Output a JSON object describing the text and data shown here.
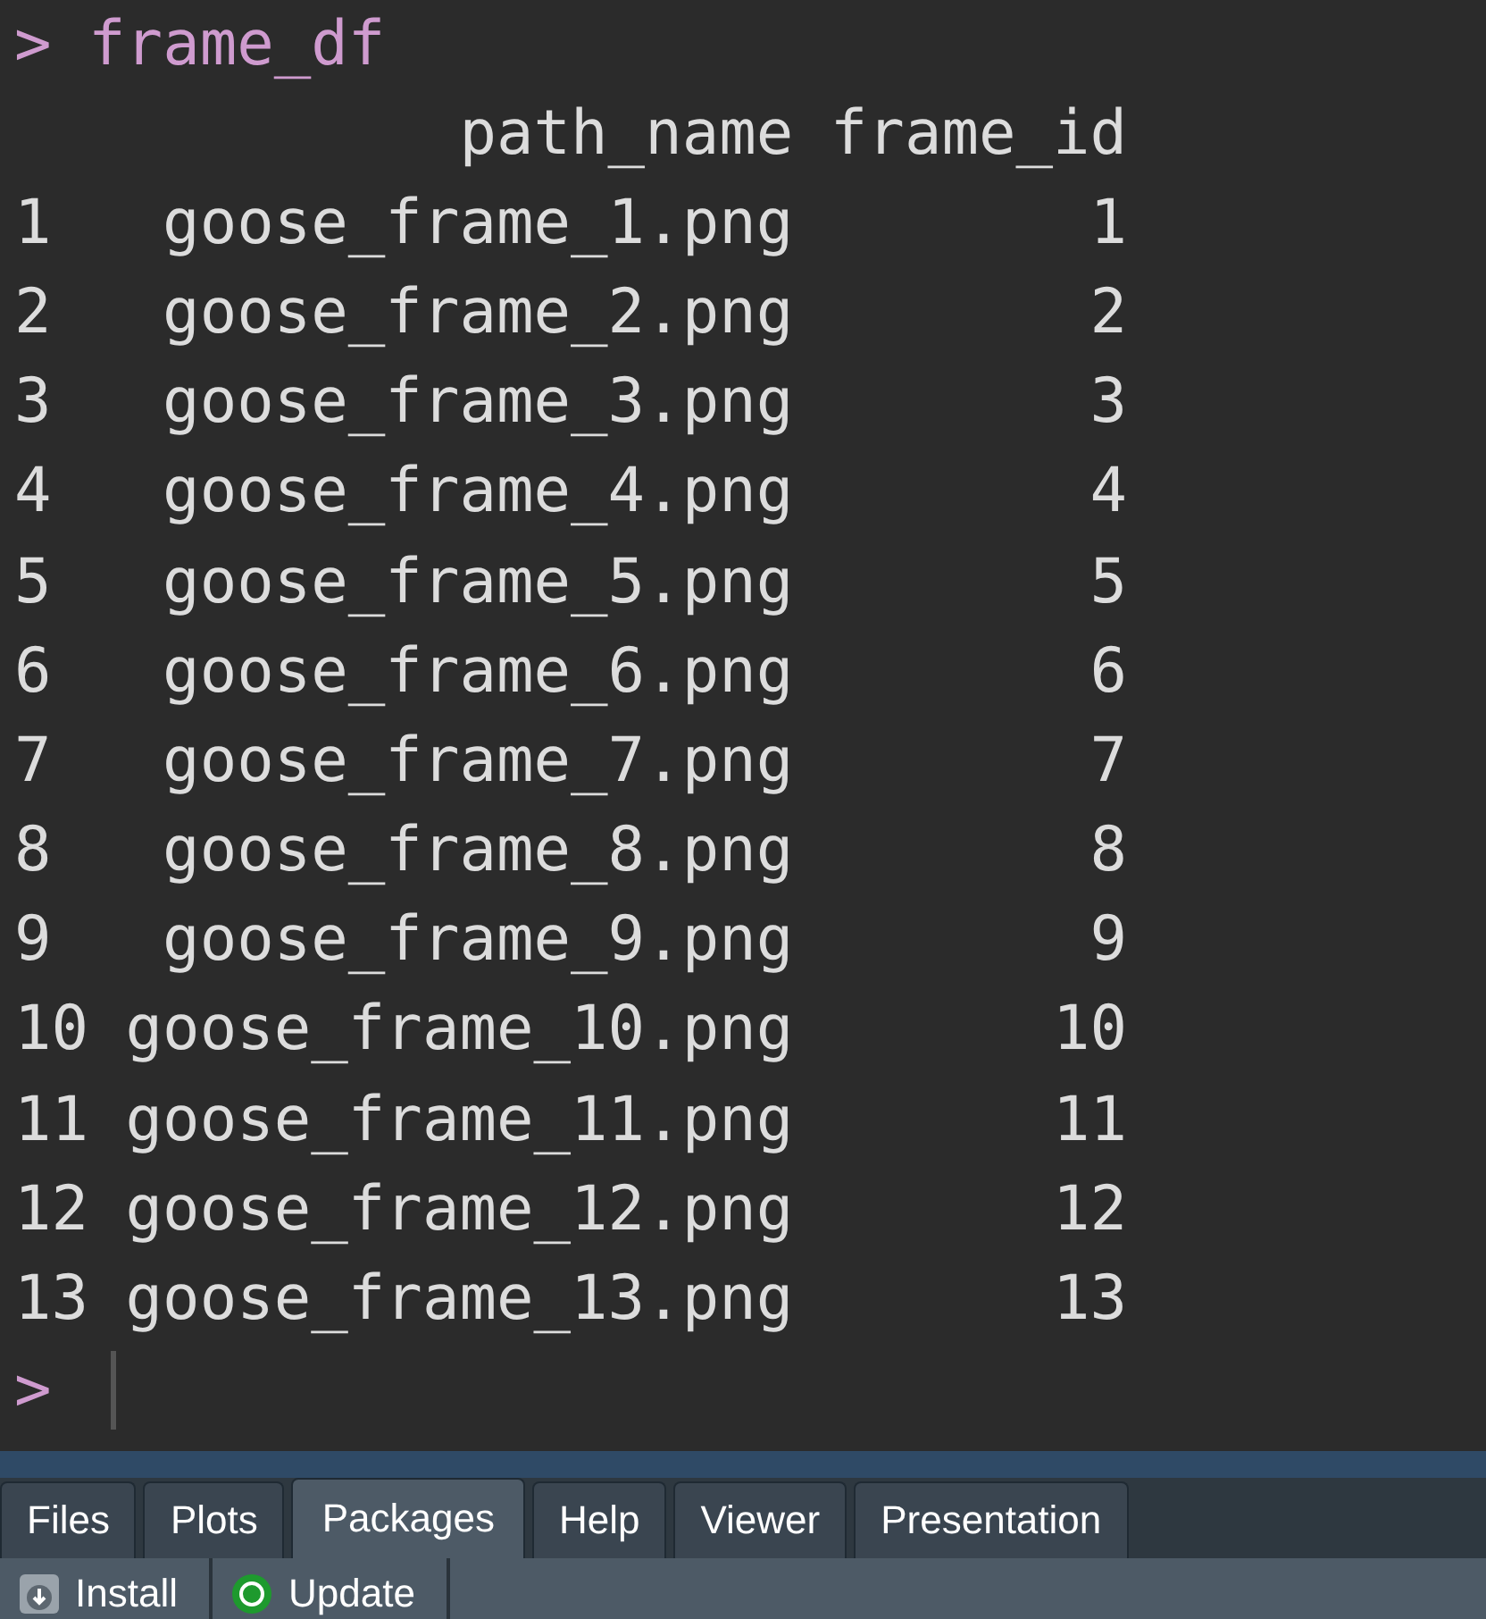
{
  "console": {
    "prompt": ">",
    "command": "frame_df",
    "columns": [
      "path_name",
      "frame_id"
    ],
    "rows": [
      {
        "index": "1",
        "path_name": "goose_frame_1.png",
        "frame_id": "1"
      },
      {
        "index": "2",
        "path_name": "goose_frame_2.png",
        "frame_id": "2"
      },
      {
        "index": "3",
        "path_name": "goose_frame_3.png",
        "frame_id": "3"
      },
      {
        "index": "4",
        "path_name": "goose_frame_4.png",
        "frame_id": "4"
      },
      {
        "index": "5",
        "path_name": "goose_frame_5.png",
        "frame_id": "5"
      },
      {
        "index": "6",
        "path_name": "goose_frame_6.png",
        "frame_id": "6"
      },
      {
        "index": "7",
        "path_name": "goose_frame_7.png",
        "frame_id": "7"
      },
      {
        "index": "8",
        "path_name": "goose_frame_8.png",
        "frame_id": "8"
      },
      {
        "index": "9",
        "path_name": "goose_frame_9.png",
        "frame_id": "9"
      },
      {
        "index": "10",
        "path_name": "goose_frame_10.png",
        "frame_id": "10"
      },
      {
        "index": "11",
        "path_name": "goose_frame_11.png",
        "frame_id": "11"
      },
      {
        "index": "12",
        "path_name": "goose_frame_12.png",
        "frame_id": "12"
      },
      {
        "index": "13",
        "path_name": "goose_frame_13.png",
        "frame_id": "13"
      }
    ],
    "input_prompt": ">"
  },
  "tabs": [
    {
      "label": "Files",
      "selected": false
    },
    {
      "label": "Plots",
      "selected": false
    },
    {
      "label": "Packages",
      "selected": true
    },
    {
      "label": "Help",
      "selected": false
    },
    {
      "label": "Viewer",
      "selected": false
    },
    {
      "label": "Presentation",
      "selected": false
    }
  ],
  "toolbar": [
    {
      "kind": "install",
      "label": "Install"
    },
    {
      "kind": "update",
      "label": "Update"
    }
  ]
}
